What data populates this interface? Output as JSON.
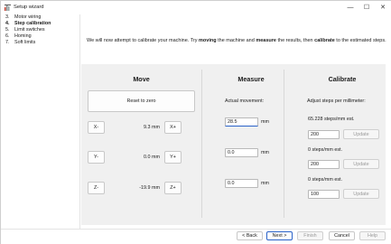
{
  "window": {
    "title": "Setup wizard",
    "minimize": "—",
    "maximize": "☐",
    "close": "✕"
  },
  "sidebar": {
    "steps": [
      {
        "num": "3.",
        "label": "Motor wiring"
      },
      {
        "num": "4.",
        "label": "Step calibration"
      },
      {
        "num": "5.",
        "label": "Limit switches"
      },
      {
        "num": "6.",
        "label": "Homing"
      },
      {
        "num": "7.",
        "label": "Soft limits"
      }
    ]
  },
  "intro": {
    "part1": "We will now attempt to calibrate your machine. Try ",
    "bold1": "moving",
    "part2": " the machine and ",
    "bold2": "measure",
    "part3": " the results, then ",
    "bold3": "calibrate",
    "part4": " to the estimated steps."
  },
  "move": {
    "heading": "Move",
    "reset_label": "Reset to zero",
    "axes": [
      {
        "minus": "X-",
        "value": "9.3 mm",
        "plus": "X+"
      },
      {
        "minus": "Y-",
        "value": "0.0 mm",
        "plus": "Y+"
      },
      {
        "minus": "Z-",
        "value": "-19.9 mm",
        "plus": "Z+"
      }
    ]
  },
  "measure": {
    "heading": "Measure",
    "actual_label": "Actual movement:",
    "unit": "mm",
    "values": [
      "28.5",
      "0.0",
      "0.0"
    ]
  },
  "calibrate": {
    "heading": "Calibrate",
    "adjust_label": "Adjust steps per millimeter:",
    "rows": [
      {
        "estimate": "65.228 steps/mm est.",
        "value": "200",
        "update": "Update"
      },
      {
        "estimate": "0 steps/mm est.",
        "value": "200",
        "update": "Update"
      },
      {
        "estimate": "0 steps/mm est.",
        "value": "100",
        "update": "Update"
      }
    ]
  },
  "footer": {
    "back": "< Back",
    "next": "Next >",
    "finish": "Finish",
    "cancel": "Cancel",
    "help": "Help"
  }
}
